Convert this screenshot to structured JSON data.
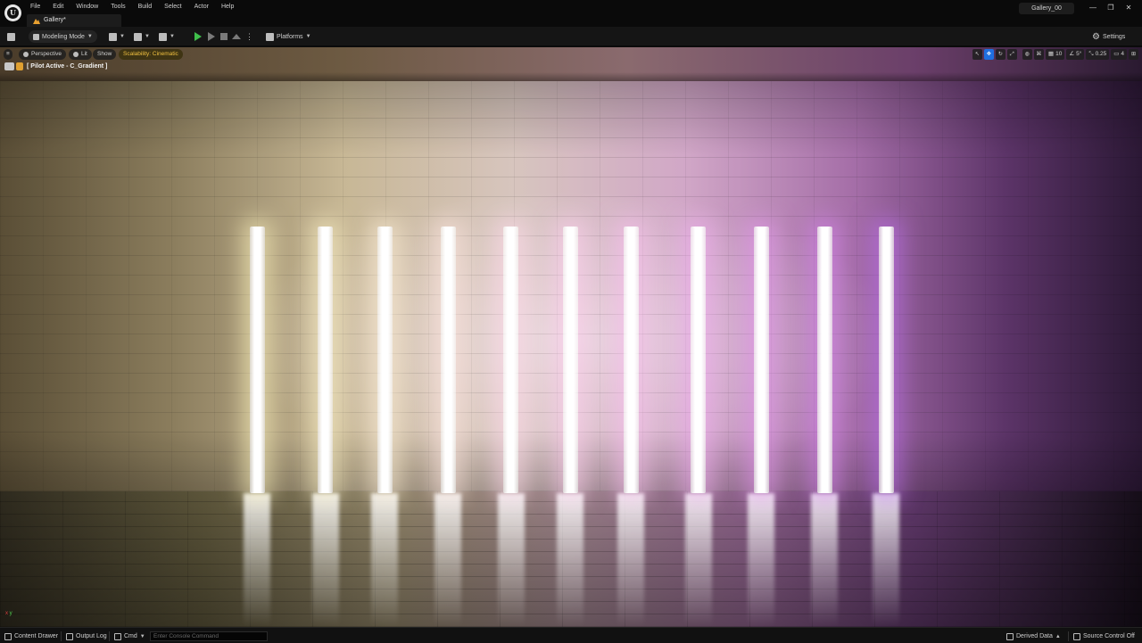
{
  "menu": [
    "File",
    "Edit",
    "Window",
    "Tools",
    "Build",
    "Select",
    "Actor",
    "Help"
  ],
  "tab": {
    "label": "Gallery*"
  },
  "project": {
    "name": "Gallery_00"
  },
  "window_controls": {
    "minimize": "—",
    "restore": "❐",
    "close": "✕"
  },
  "toolbar": {
    "mode_label": "Modeling Mode",
    "platforms_label": "Platforms",
    "settings_label": "Settings"
  },
  "viewport": {
    "perspective_label": "Perspective",
    "lit_label": "Lit",
    "show_label": "Show",
    "scalability_label": "Scalability: Cinematic",
    "pilot_label": "[ Pilot Active - C_Gradient ]",
    "grid_snap": "10",
    "rotation_snap": "5°",
    "scale_snap": "0.25",
    "camera_speed": "4",
    "axis_x": "x",
    "axis_y": "y"
  },
  "statusbar": {
    "content_drawer": "Content Drawer",
    "output_log": "Output Log",
    "cmd_label": "Cmd",
    "console_placeholder": "Enter Console Command",
    "derived_data": "Derived Data",
    "source_control": "Source Control Off"
  }
}
